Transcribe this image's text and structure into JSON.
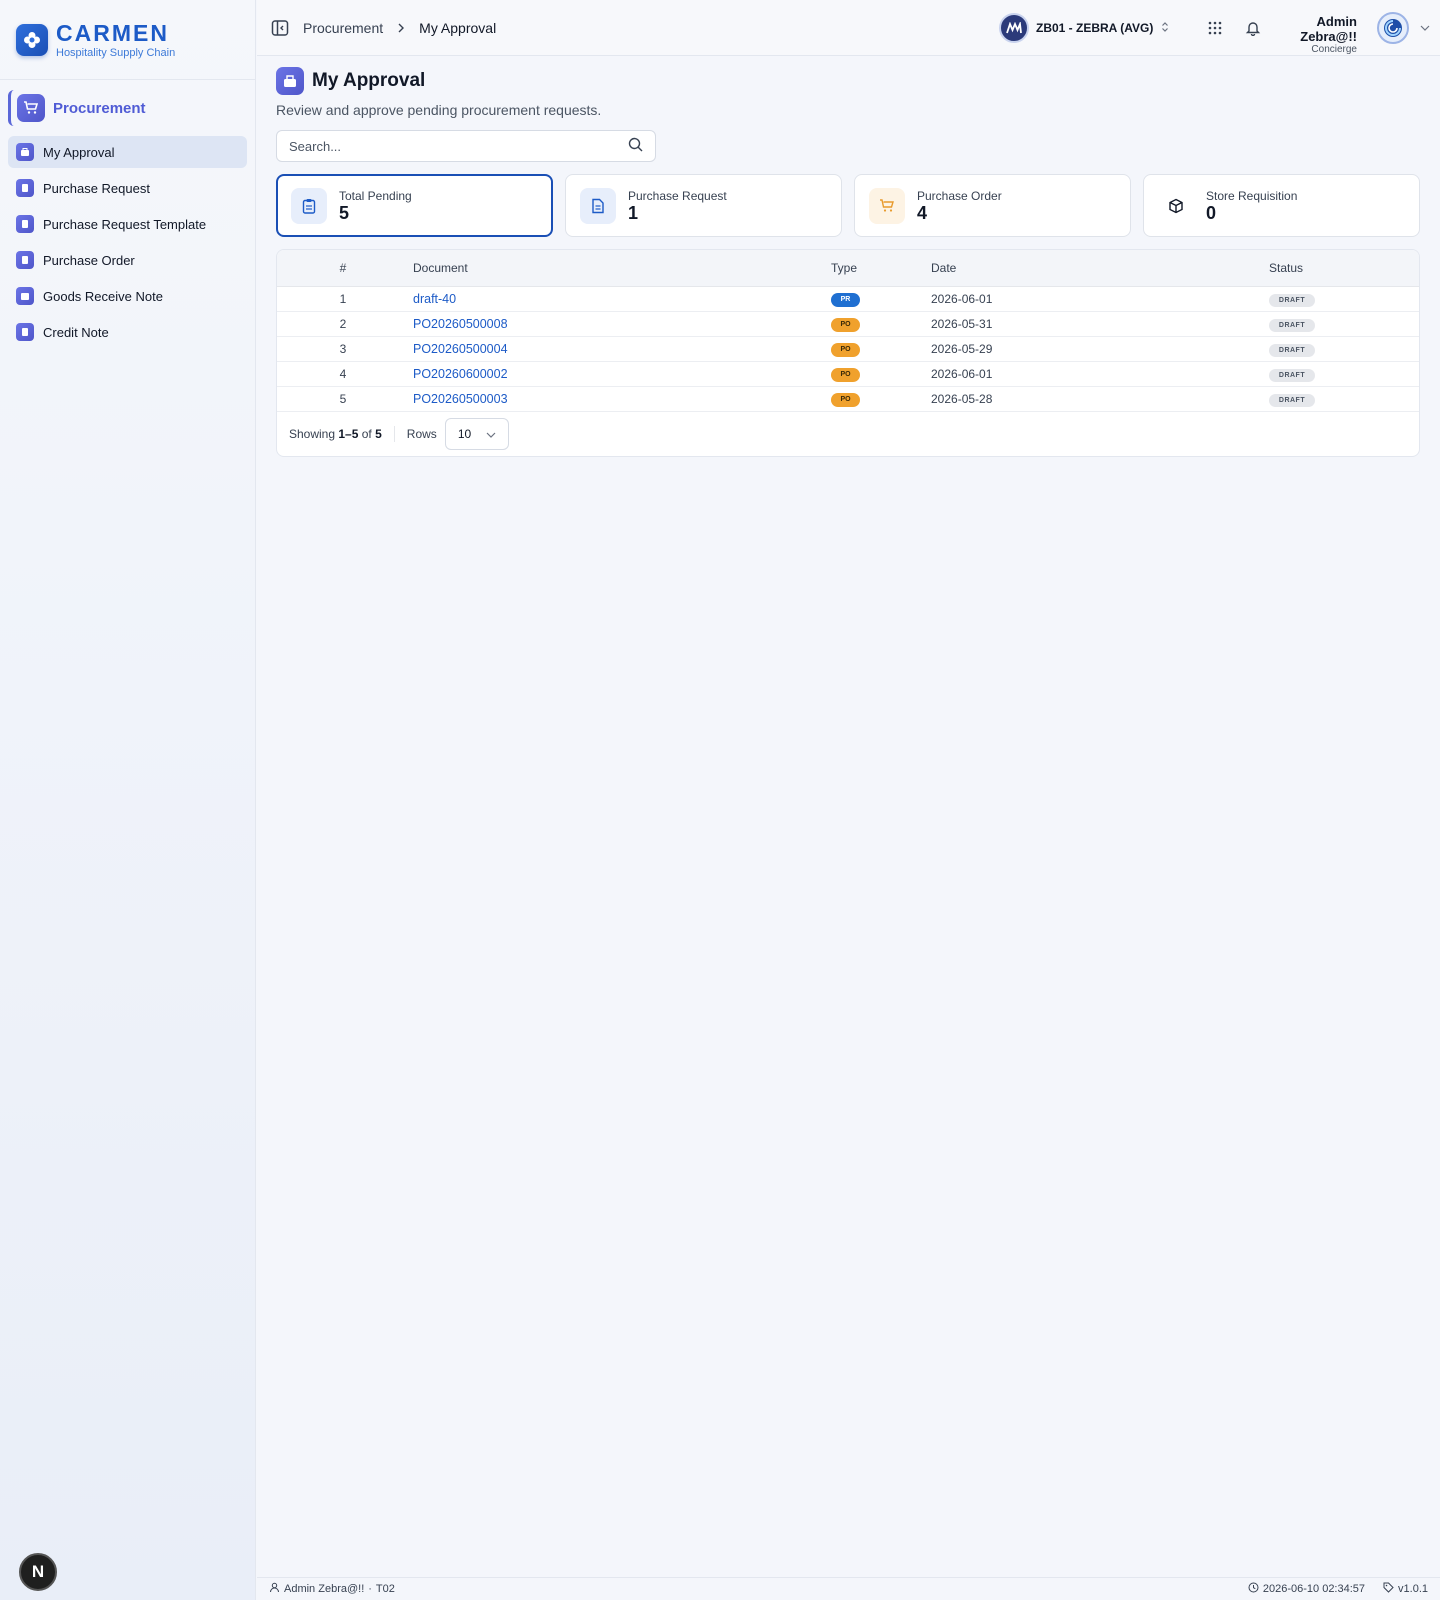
{
  "brand": {
    "title": "CARMEN",
    "subtitle": "Hospitality Supply Chain",
    "logo_icon": "flower-icon",
    "color": "#1d5bc7"
  },
  "sidebar": {
    "module": {
      "label": "Procurement",
      "icon": "cart-icon"
    },
    "items": [
      {
        "label": "My Approval",
        "icon": "approval-icon",
        "active": true
      },
      {
        "label": "Purchase Request",
        "icon": "document-icon",
        "active": false
      },
      {
        "label": "Purchase Request Template",
        "icon": "document-icon",
        "active": false
      },
      {
        "label": "Purchase Order",
        "icon": "document-icon",
        "active": false
      },
      {
        "label": "Goods Receive Note",
        "icon": "package-icon",
        "active": false
      },
      {
        "label": "Credit Note",
        "icon": "document-icon",
        "active": false
      }
    ],
    "badge": "N"
  },
  "topbar": {
    "breadcrumb": [
      "Procurement",
      "My Approval"
    ],
    "org_name": "ZB01 - ZEBRA (AVG)",
    "user_name": "Admin Zebra@!!",
    "user_role": "Concierge"
  },
  "page": {
    "title": "My Approval",
    "description": "Review and approve pending procurement requests.",
    "search_placeholder": "Search..."
  },
  "stats": [
    {
      "label": "Total Pending",
      "value": "5",
      "icon": "clipboard-icon",
      "active": true
    },
    {
      "label": "Purchase Request",
      "value": "1",
      "icon": "file-text-icon",
      "active": false
    },
    {
      "label": "Purchase Order",
      "value": "4",
      "icon": "cart-icon",
      "active": false
    },
    {
      "label": "Store Requisition",
      "value": "0",
      "icon": "box-icon",
      "active": false
    }
  ],
  "table": {
    "headers": [
      "#",
      "Document",
      "Type",
      "Date",
      "Status"
    ],
    "rows": [
      {
        "num": "1",
        "document": "draft-40",
        "type": "PR",
        "date": "2026-06-01",
        "status": "DRAFT"
      },
      {
        "num": "2",
        "document": "PO20260500008",
        "type": "PO",
        "date": "2026-05-31",
        "status": "DRAFT"
      },
      {
        "num": "3",
        "document": "PO20260500004",
        "type": "PO",
        "date": "2026-05-29",
        "status": "DRAFT"
      },
      {
        "num": "4",
        "document": "PO20260600002",
        "type": "PO",
        "date": "2026-06-01",
        "status": "DRAFT"
      },
      {
        "num": "5",
        "document": "PO20260500003",
        "type": "PO",
        "date": "2026-05-28",
        "status": "DRAFT"
      }
    ]
  },
  "pager": {
    "showing": "Showing",
    "range": "1–5",
    "of": "of",
    "total": "5",
    "rows_label": "Rows",
    "rows_value": "10"
  },
  "footer": {
    "user": "Admin Zebra@!!",
    "separator": "·",
    "code": "T02",
    "timestamp": "2026-06-10 02:34:57",
    "version": "v1.0.1"
  },
  "colors": {
    "accent": "#1a4fb5",
    "module": "#4f5bd5",
    "pr_badge": "#1f6fd1",
    "po_badge": "#f0a12d"
  }
}
